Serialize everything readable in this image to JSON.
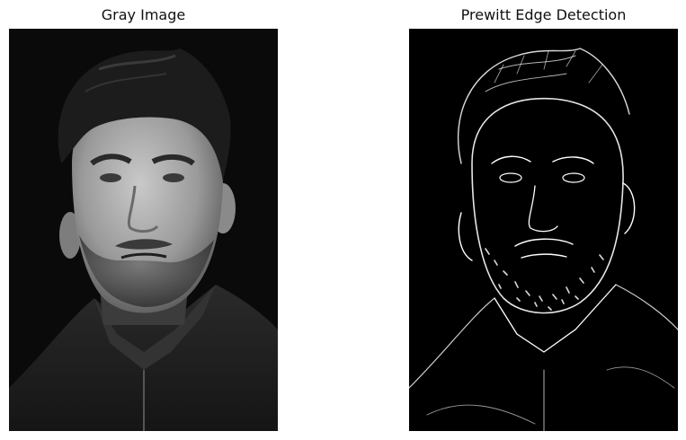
{
  "figure": {
    "panels": [
      {
        "title": "Gray Image",
        "content": "grayscale portrait photograph"
      },
      {
        "title": "Prewitt Edge Detection",
        "content": "edge map of the same portrait, white edges on black"
      }
    ]
  },
  "colors": {
    "background": "#ffffff",
    "photo_backdrop": "#0a0a0a",
    "edge_background": "#000000",
    "edge_lines": "#ffffff",
    "title_text": "#111111"
  }
}
